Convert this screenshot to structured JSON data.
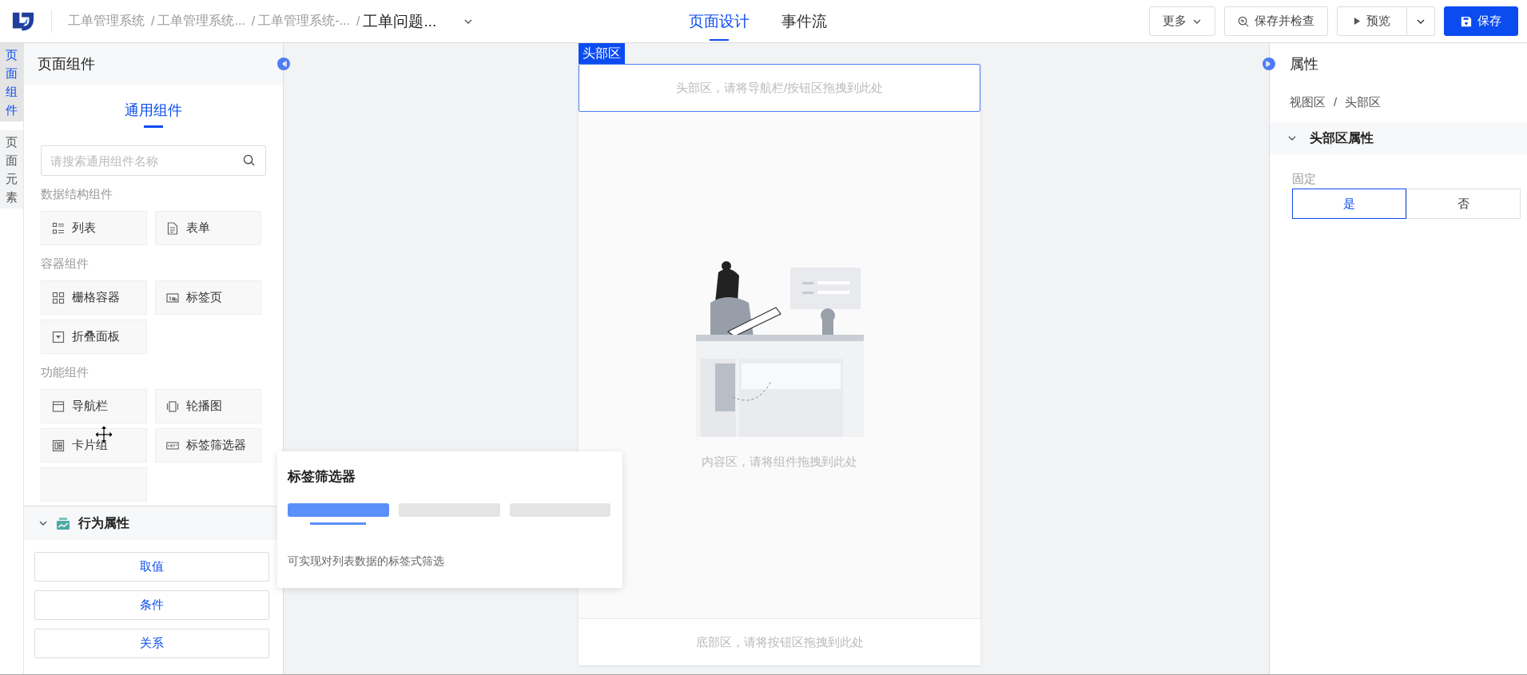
{
  "topbar": {
    "separator": "/",
    "breadcrumbs": [
      {
        "text": "工单管理系统",
        "current": false
      },
      {
        "text": "工单管理系统...",
        "current": false
      },
      {
        "text": "工单管理系统-...",
        "current": false
      },
      {
        "text": "工单问题...",
        "current": true
      }
    ],
    "tabs": [
      {
        "label": "页面设计",
        "selected": true
      },
      {
        "label": "事件流",
        "selected": false
      }
    ],
    "actions": {
      "more": "更多",
      "save_check": "保存并检查",
      "preview": "预览",
      "save": "保存"
    }
  },
  "left_rail": [
    {
      "label": "页面组件",
      "selected": true
    },
    {
      "label": "页面元素",
      "selected": false
    }
  ],
  "component_panel": {
    "title": "页面组件",
    "category_tabs": [
      {
        "label": "通用组件",
        "selected": true
      }
    ],
    "search": {
      "placeholder": "请搜索通用组件名称"
    },
    "groups": [
      {
        "title": "数据结构组件",
        "items": [
          {
            "label": "列表",
            "kind": "list"
          },
          {
            "label": "表单",
            "kind": "form"
          }
        ]
      },
      {
        "title": "容器组件",
        "items": [
          {
            "label": "栅格容器",
            "kind": "grid"
          },
          {
            "label": "标签页",
            "kind": "tabs"
          },
          {
            "label": "折叠面板",
            "kind": "collapse"
          }
        ]
      },
      {
        "title": "功能组件",
        "items": [
          {
            "label": "导航栏",
            "kind": "navbar"
          },
          {
            "label": "轮播图",
            "kind": "carousel"
          },
          {
            "label": "卡片组",
            "kind": "cards"
          },
          {
            "label": "标签筛选器",
            "kind": "tagfilter"
          },
          {
            "kind": "blank"
          }
        ]
      }
    ]
  },
  "behavior": {
    "title": "行为属性",
    "expanded": true,
    "buttons": [
      "取值",
      "条件",
      "关系"
    ]
  },
  "tooltip": {
    "title": "标签筛选器",
    "description": "可实现对列表数据的标签式筛选"
  },
  "canvas": {
    "header_tag": "头部区",
    "header_selected": true,
    "header_hint": "头部区，请将导航栏/按钮区拖拽到此处",
    "content_hint": "内容区，请将组件拖拽到此处",
    "footer_hint": "底部区，请将按钮区拖拽到此处"
  },
  "properties": {
    "title": "属性",
    "path": [
      "视图区",
      "头部区"
    ],
    "separator": "/",
    "section": {
      "title": "头部区属性",
      "expanded": true
    },
    "field": {
      "label": "固定",
      "options": [
        {
          "label": "是",
          "selected": true
        },
        {
          "label": "否",
          "selected": false
        }
      ]
    }
  }
}
